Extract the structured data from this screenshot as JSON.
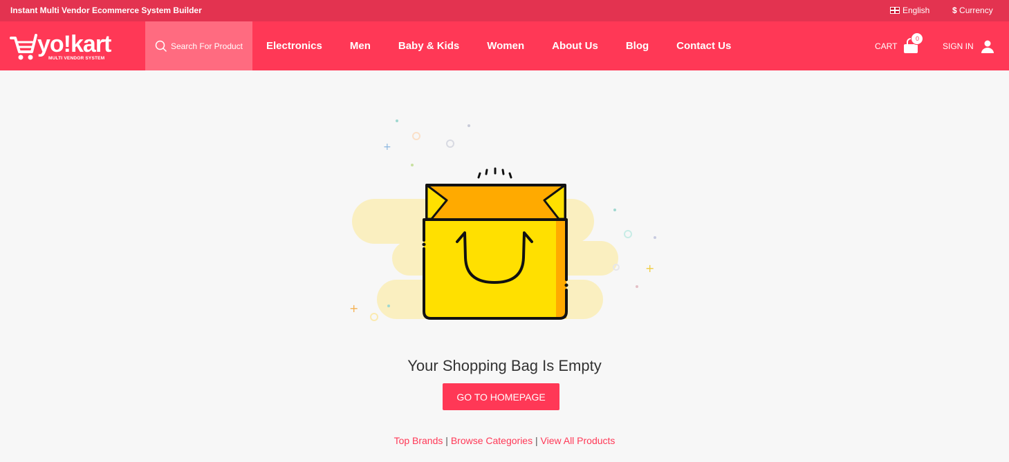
{
  "topbar": {
    "tagline": "Instant Multi Vendor Ecommerce System Builder",
    "language": "English",
    "currency_symbol": "$",
    "currency": "Currency"
  },
  "header": {
    "logo_text": "yo!kart",
    "logo_subtext": "MULTI VENDOR SYSTEM",
    "search_label": "Search For Product",
    "nav": [
      "Electronics",
      "Men",
      "Baby & Kids",
      "Women",
      "About Us",
      "Blog",
      "Contact Us"
    ],
    "cart_label": "CART",
    "cart_count": "0",
    "signin_label": "SIGN IN"
  },
  "main": {
    "empty_title": "Your Shopping Bag Is Empty",
    "home_button": "GO TO HOMEPAGE",
    "links": [
      "Top Brands",
      "Browse Categories",
      "View All Products"
    ],
    "separator": "|"
  },
  "colors": {
    "accent": "#ff3856",
    "topbar": "#e33350",
    "bag": "#ffe000",
    "bag_flap": "#ffaa00"
  }
}
